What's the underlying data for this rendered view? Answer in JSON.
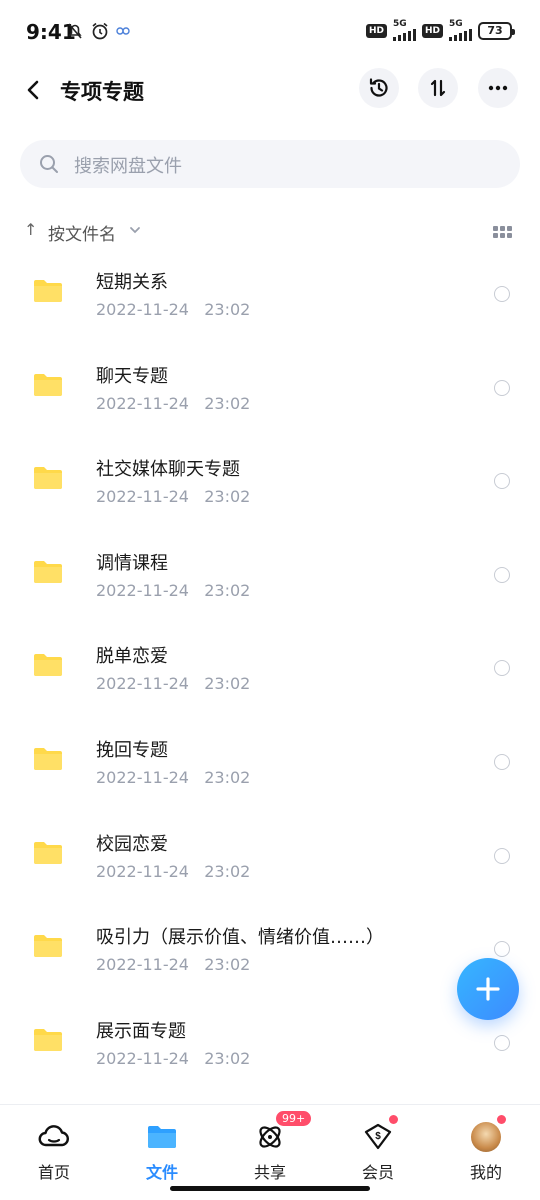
{
  "status_bar": {
    "time": "9:41",
    "left_icons": [
      "mute-bell-icon",
      "alarm-icon",
      "link-icon"
    ],
    "hd_1": "HD",
    "net_1": "5G",
    "hd_2": "HD",
    "net_2": "5G",
    "battery": "73"
  },
  "header": {
    "title": "专项专题",
    "back_icon": "chevron-left-icon",
    "actions": [
      "history-icon",
      "sort-swap-icon",
      "more-icon"
    ]
  },
  "search": {
    "placeholder": "搜索网盘文件"
  },
  "sort": {
    "arrow": "↑",
    "label": "按文件名"
  },
  "files": [
    {
      "name": "短期关系",
      "date": "2022-11-24",
      "time": "23:02"
    },
    {
      "name": "聊天专题",
      "date": "2022-11-24",
      "time": "23:02"
    },
    {
      "name": "社交媒体聊天专题",
      "date": "2022-11-24",
      "time": "23:02"
    },
    {
      "name": "调情课程",
      "date": "2022-11-24",
      "time": "23:02"
    },
    {
      "name": "脱单恋爱",
      "date": "2022-11-24",
      "time": "23:02"
    },
    {
      "name": "挽回专题",
      "date": "2022-11-24",
      "time": "23:02"
    },
    {
      "name": "校园恋爱",
      "date": "2022-11-24",
      "time": "23:02"
    },
    {
      "name": "吸引力（展示价值、情绪价值……）",
      "date": "2022-11-24",
      "time": "23:02"
    },
    {
      "name": "展示面专题",
      "date": "2022-11-24",
      "time": "23:02"
    }
  ],
  "nav": [
    {
      "label": "首页",
      "icon": "cloud-icon",
      "active": false
    },
    {
      "label": "文件",
      "icon": "folder-icon",
      "active": true
    },
    {
      "label": "共享",
      "icon": "share-orbit-icon",
      "active": false,
      "badge": "99+"
    },
    {
      "label": "会员",
      "icon": "vip-diamond-icon",
      "active": false,
      "dot": true
    },
    {
      "label": "我的",
      "icon": "avatar-icon",
      "active": false,
      "dot": true
    }
  ],
  "colors": {
    "accent": "#2a8cff",
    "folder": "#ffd94a",
    "badge": "#ff4d6a"
  }
}
